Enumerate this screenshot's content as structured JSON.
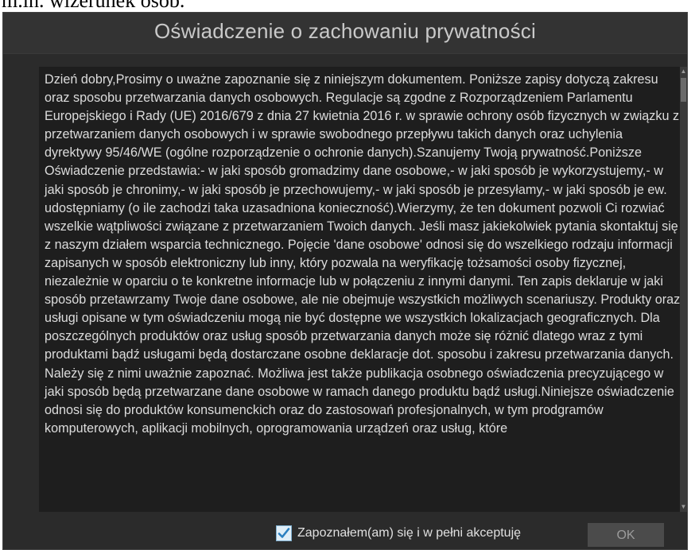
{
  "top_cut_text": "m.in. wizerunek osób.",
  "dialog": {
    "title": "Oświadczenie o zachowaniu prywatności",
    "body": "Dzień dobry,Prosimy o uważne zapoznanie się z niniejszym dokumentem. Poniższe zapisy dotyczą zakresu oraz sposobu przetwarzania danych osobowych. Regulacje są zgodne z Rozporządzeniem Parlamentu Europejskiego i Rady (UE) 2016/679 z dnia 27 kwietnia 2016 r. w sprawie ochrony osób fizycznych w związku z przetwarzaniem danych osobowych i w sprawie swobodnego przepływu takich danych oraz uchylenia dyrektywy 95/46/WE (ogólne rozporządzenie o ochronie danych).Szanujemy Twoją prywatność.Poniższe Oświadczenie przedstawia:- w jaki sposób gromadzimy dane osobowe,- w jaki sposób je wykorzystujemy,- w jaki sposób je chronimy,- w jaki sposób je przechowujemy,- w jaki sposób je przesyłamy,- w jaki sposób je ew. udostępniamy (o ile zachodzi taka uzasadniona konieczność).Wierzymy, że ten dokument pozwoli Ci rozwiać wszelkie wątpliwości związane z przetwarzaniem Twoich danych. Jeśli masz jakiekolwiek pytania skontaktuj się z naszym działem wsparcia technicznego. Pojęcie 'dane osobowe' odnosi się do wszelkiego rodzaju informacji zapisanych w sposób elektroniczny lub inny, który pozwala na weryfikację tożsamości osoby fizycznej, niezależnie w oparciu o te konkretne informacje lub w połączeniu z innymi danymi. Ten zapis deklaruje w jaki sposób przetawrzamy Twoje dane osobowe, ale nie obejmuje wszystkich możliwych scenariuszy. Produkty oraz usługi opisane w tym oświadczeniu mogą nie być dostępne we wszystkich lokalizacjach geograficznych. Dla poszczególnych produktów oraz usług sposób przetwarzania danych może się różnić dlatego wraz z tymi produktami bądź usługami będą dostarczane osobne deklaracje dot. sposobu i zakresu przetwarzania danych. Należy się z nimi uważnie zapoznać. Możliwa jest także publikacja osobnego oświadczenia precyzującego w jaki sposób będą przetwarzane dane osobowe w ramach danego produktu bądź usługi.Niniejsze oświadczenie odnosi się do produktów konsumenckich oraz do zastosowań profesjonalnych, w tym prodgramów komputerowych, aplikacji mobilnych, oprogramowania urządzeń oraz usług, które",
    "accept_label": "Zapoznałem(am) się i w pełni akceptuję",
    "accept_checked": true,
    "ok_label": "OK"
  },
  "colors": {
    "dialog_bg": "#2b2b2b",
    "text_panel_bg": "#1e1e1e",
    "text": "#dcdcdc",
    "checkbox_check": "#2a7fc0"
  },
  "icons": {
    "checkbox": "checkmark-icon",
    "scroll_up": "scroll-up-arrow-icon",
    "scroll_down": "scroll-down-arrow-icon"
  }
}
